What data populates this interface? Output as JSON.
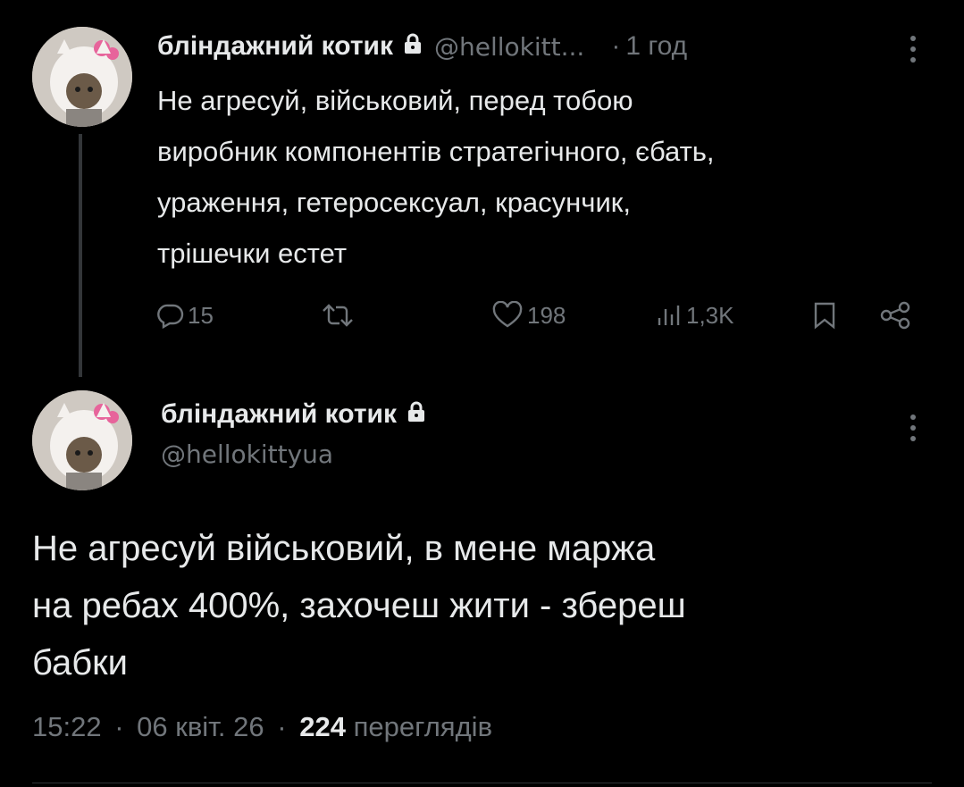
{
  "tweet1": {
    "display_name": "бліндажний котик",
    "handle": "@hellokitt...",
    "separator": "·",
    "time": "1 год",
    "lines": [
      "Не агресуй, військовий, перед тобою",
      "виробник компонентів стратегічного, єбать,",
      "ураження, гетеросексуал, красунчик,",
      "трішечки естет"
    ],
    "replies": "15",
    "likes": "198",
    "views": "1,3K"
  },
  "tweet2": {
    "display_name": "бліндажний котик",
    "handle": "@hellokittyua",
    "lines": [
      "Не агресуй військовий, в мене маржа",
      "на ребах 400%, захочеш жити - збереш",
      "бабки"
    ],
    "time": "15:22",
    "sep1": "·",
    "date": "06 квіт. 26",
    "sep2": "·",
    "views_count": "224",
    "views_label": "переглядів"
  },
  "icons": {
    "reply": "reply-icon",
    "retweet": "retweet-icon",
    "like": "heart-icon",
    "views": "views-chart-icon",
    "bookmark": "bookmark-icon",
    "share": "share-icon",
    "lock": "lock-icon",
    "more": "more-vertical-icon"
  },
  "colors": {
    "background": "#000000",
    "text": "#e7e9ea",
    "muted": "#71767b",
    "line": "#333639"
  }
}
